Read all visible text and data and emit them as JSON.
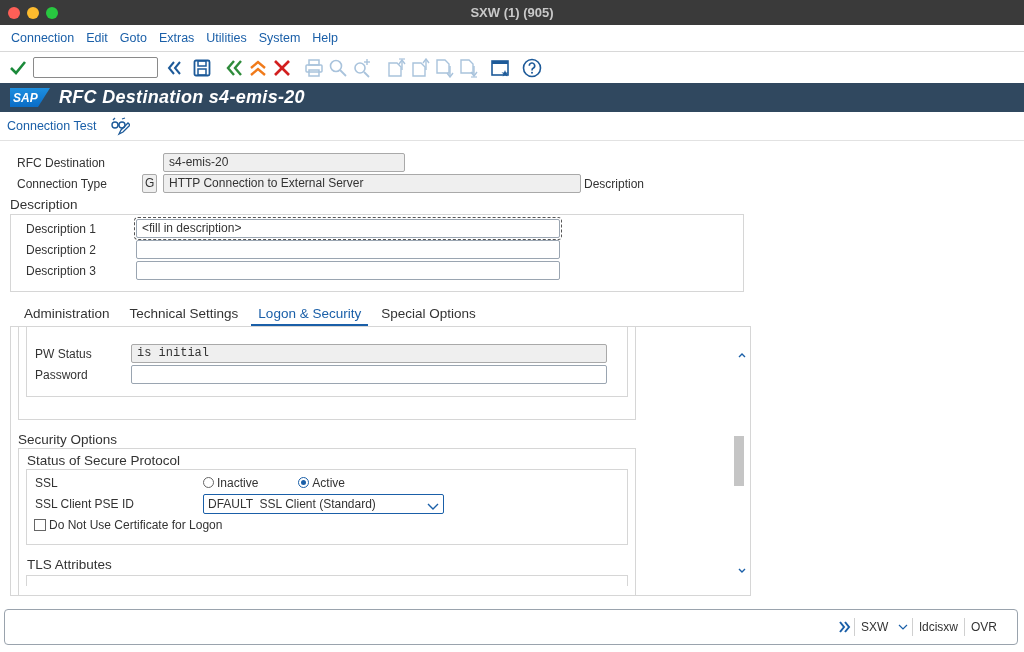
{
  "window": {
    "title": "SXW (1) (905)"
  },
  "menu": [
    {
      "label": "Connection"
    },
    {
      "label": "Edit"
    },
    {
      "label": "Goto"
    },
    {
      "label": "Extras"
    },
    {
      "label": "Utilities"
    },
    {
      "label": "System"
    },
    {
      "label": "Help"
    }
  ],
  "toolbar": {
    "buttons": [
      {
        "kind": "enter",
        "disabled": false
      },
      {
        "kind": "collapse",
        "disabled": false
      },
      {
        "kind": "save",
        "disabled": false
      },
      {
        "kind": "back",
        "disabled": false
      },
      {
        "kind": "exit",
        "disabled": false
      },
      {
        "kind": "cancel",
        "disabled": false
      },
      {
        "kind": "print",
        "disabled": true
      },
      {
        "kind": "find",
        "disabled": true
      },
      {
        "kind": "find_next",
        "disabled": true
      },
      {
        "kind": "first_page",
        "disabled": true
      },
      {
        "kind": "previous_page",
        "disabled": true
      },
      {
        "kind": "next_page",
        "disabled": true
      },
      {
        "kind": "last_page",
        "disabled": true
      },
      {
        "kind": "layout",
        "disabled": false
      },
      {
        "kind": "help",
        "disabled": false
      }
    ]
  },
  "header": {
    "logo": "SAP",
    "title": "RFC Destination s4-emis-20"
  },
  "app_toolbar": {
    "buttons": [
      {
        "kind": "text",
        "label": "Connection Test"
      },
      {
        "kind": "icon"
      }
    ]
  },
  "rfc_destination": {
    "label": "RFC Destination",
    "value": "s4-emis-20",
    "readonly": true
  },
  "connection_type": {
    "label": "Connection Type",
    "code": "G",
    "value": "HTTP Connection to External Server",
    "readonly": true,
    "suffix": "Description"
  },
  "description": {
    "title": "Description",
    "fields": [
      {
        "label": "Description 1",
        "value": "<fill in description>",
        "focused": true
      },
      {
        "label": "Description 2",
        "focused": false
      },
      {
        "label": "Description 3",
        "focused": false
      }
    ]
  },
  "tabs": [
    {
      "label": "Administration",
      "selected": false
    },
    {
      "label": "Technical Settings",
      "selected": false
    },
    {
      "label": "Logon & Security",
      "selected": true
    },
    {
      "label": "Special Options",
      "selected": false
    }
  ],
  "logon": {
    "fields": [
      {
        "label": "PW Status",
        "value": "is initial",
        "readonly": true
      },
      {
        "label": "Password",
        "readonly": false
      }
    ]
  },
  "security": {
    "title": "Security Options",
    "group_title": "Status of Secure Protocol",
    "ssl": {
      "label": "SSL",
      "options": [
        {
          "label": "Inactive",
          "selected": false
        },
        {
          "label": "Active",
          "selected": true
        }
      ]
    },
    "pse": {
      "label": "SSL Client PSE ID",
      "value": "DFAULT  SSL Client (Standard)"
    },
    "no_cert": {
      "label": "Do Not Use Certificate for Logon",
      "checked": false
    },
    "tls_title": "TLS Attributes"
  },
  "status_bar": {
    "system": "SXW",
    "server": "ldcisxw",
    "mode": "OVR"
  }
}
